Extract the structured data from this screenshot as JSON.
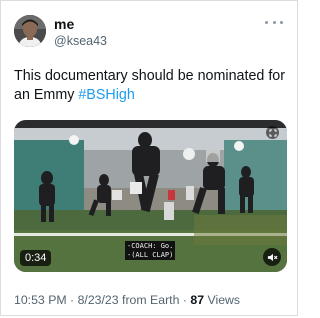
{
  "author": {
    "display_name": "me",
    "handle": "@ksea43"
  },
  "tweet": {
    "text": "This documentary should be nominated for an Emmy ",
    "hashtag": "#BSHigh"
  },
  "video": {
    "caption_line1": "-COACH: Go.",
    "caption_line2": "-(ALL CLAP)",
    "duration": "0:34"
  },
  "meta": {
    "time": "10:53 PM",
    "separator1": " · ",
    "date": "8/23/23",
    "source": " from Earth",
    "separator2": " · ",
    "views_count": "87",
    "views_label": " Views"
  },
  "icons": {
    "more": "more-dots-icon",
    "mute": "speaker-muted-icon",
    "expand": "expand-icon"
  },
  "colors": {
    "link": "#1d9bf0",
    "text": "#0f1419",
    "secondary": "#536471"
  }
}
